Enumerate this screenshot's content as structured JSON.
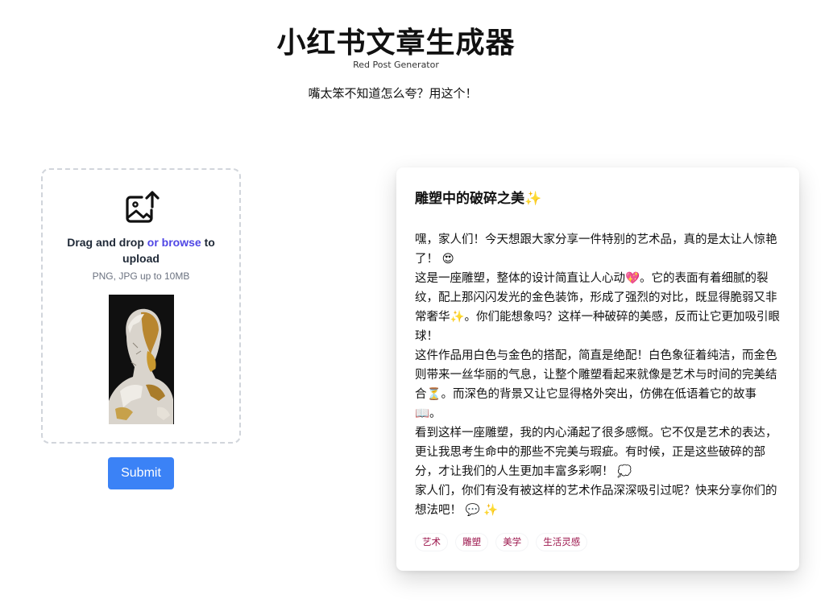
{
  "header": {
    "title": "小红书文章生成器",
    "subtitle": "Red Post Generator",
    "tagline": "嘴太笨不知道怎么夸？用这个！"
  },
  "upload": {
    "drag_text": "Drag and drop",
    "browse_link": "or browse",
    "to_upload": "to upload",
    "hint": "PNG, JPG up to 10MB",
    "icon": "image-upload-icon"
  },
  "submit": {
    "label": "Submit"
  },
  "post": {
    "title": "雕塑中的破碎之美✨",
    "paragraphs": [
      "嘿，家人们！今天想跟大家分享一件特别的艺术品，真的是太让人惊艳了！ 😍",
      "这是一座雕塑，整体的设计简直让人心动💖。它的表面有着细腻的裂纹，配上那闪闪发光的金色装饰，形成了强烈的对比，既显得脆弱又非常奢华✨。你们能想象吗？这样一种破碎的美感，反而让它更加吸引眼球！",
      "这件作品用白色与金色的搭配，简直是绝配！白色象征着纯洁，而金色则带来一丝华丽的气息，让整个雕塑看起来就像是艺术与时间的完美结合⏳。而深色的背景又让它显得格外突出，仿佛在低语着它的故事📖。",
      "看到这样一座雕塑，我的内心涌起了很多感慨。它不仅是艺术的表达，更让我思考生命中的那些不完美与瑕疵。有时候，正是这些破碎的部分，才让我们的人生更加丰富多彩啊！ 💭",
      "家人们，你们有没有被这样的艺术作品深深吸引过呢？快来分享你们的想法吧！ 💬 ✨"
    ],
    "tags": [
      "艺术",
      "雕塑",
      "美学",
      "生活灵感"
    ]
  },
  "colors": {
    "accent": "#3b82f6",
    "browse_link": "#4f46e5",
    "tag_text": "#9d174d"
  }
}
